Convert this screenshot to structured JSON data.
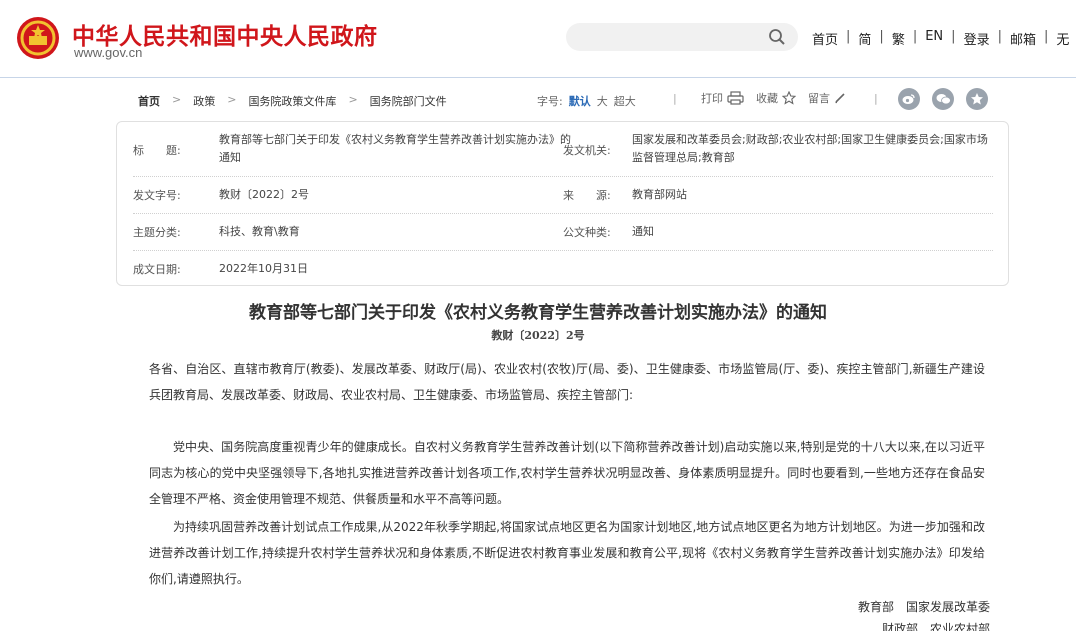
{
  "header": {
    "site_title": "中华人民共和国中央人民政府",
    "site_url": "www.gov.cn",
    "search_placeholder": "",
    "nav": [
      "首页",
      "简",
      "繁",
      "EN",
      "登录",
      "邮箱",
      "无"
    ],
    "colors": {
      "brand_red": "#d0161b",
      "link_blue": "#2b6ab6"
    }
  },
  "breadcrumb": [
    "首页",
    "政策",
    "国务院政策文件库",
    "国务院部门文件"
  ],
  "toolbar": {
    "font_size_label": "字号:",
    "font_sizes": [
      "默认",
      "大",
      "超大"
    ],
    "print_label": "打印",
    "favorite_label": "收藏",
    "comment_label": "留言",
    "share_icons": [
      "weibo-icon",
      "wechat-icon",
      "qzone-icon"
    ]
  },
  "info": {
    "title_label": "标　　题:",
    "title_value": "教育部等七部门关于印发《农村义务教育学生营养改善计划实施办法》的通知",
    "issuer_label": "发文机关:",
    "issuer_value": "国家发展和改革委员会;财政部;农业农村部;国家卫生健康委员会;国家市场监督管理总局;教育部",
    "docno_label": "发文字号:",
    "docno_value": "教财〔2022〕2号",
    "source_label": "来　　源:",
    "source_value": "教育部网站",
    "topic_label": "主题分类:",
    "topic_value": "科技、教育\\教育",
    "type_label": "公文种类:",
    "type_value": "通知",
    "date_label": "成文日期:",
    "date_value": "2022年10月31日"
  },
  "article": {
    "title": "教育部等七部门关于印发《农村义务教育学生营养改善计划实施办法》的通知",
    "doc_no": "教财〔2022〕2号",
    "addressees": "各省、自治区、直辖市教育厅(教委)、发展改革委、财政厅(局)、农业农村(农牧)厅(局、委)、卫生健康委、市场监管局(厅、委)、疾控主管部门,新疆生产建设兵团教育局、发展改革委、财政局、农业农村局、卫生健康委、市场监管局、疾控主管部门:",
    "para1": "党中央、国务院高度重视青少年的健康成长。自农村义务教育学生营养改善计划(以下简称营养改善计划)启动实施以来,特别是党的十八大以来,在以习近平同志为核心的党中央坚强领导下,各地扎实推进营养改善计划各项工作,农村学生营养状况明显改善、身体素质明显提升。同时也要看到,一些地方还存在食品安全管理不严格、资金使用管理不规范、供餐质量和水平不高等问题。",
    "para2": "为持续巩固营养改善计划试点工作成果,从2022年秋季学期起,将国家试点地区更名为国家计划地区,地方试点地区更名为地方计划地区。为进一步加强和改进营养改善计划工作,持续提升农村学生营养状况和身体素质,不断促进农村教育事业发展和教育公平,现将《农村义务教育学生营养改善计划实施办法》印发给你们,请遵照执行。",
    "sign1": "教育部　国家发展改革委",
    "sign2": "财政部　农业农村部"
  }
}
